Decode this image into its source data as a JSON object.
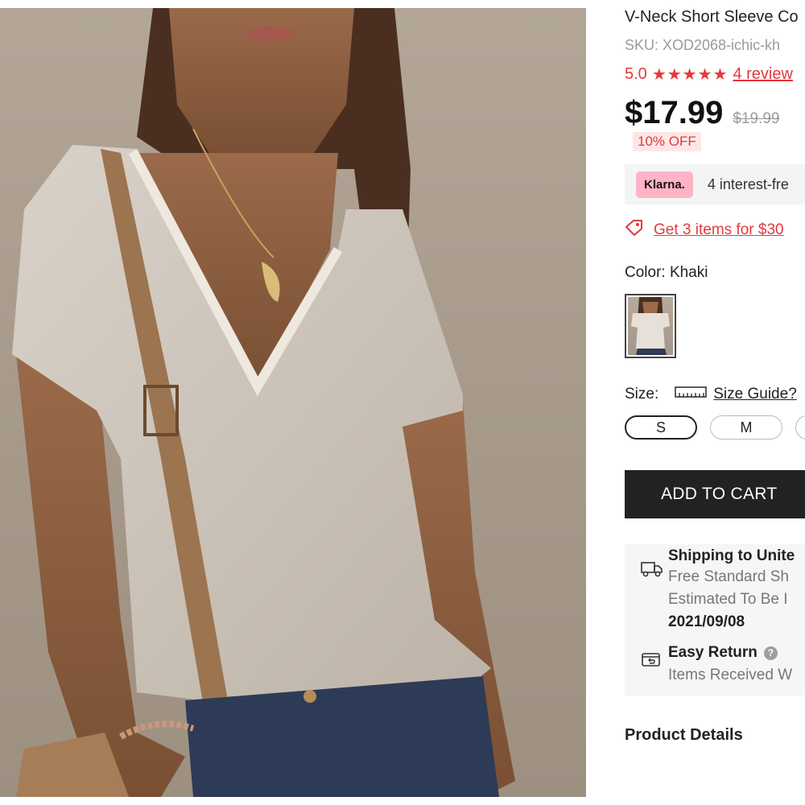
{
  "product": {
    "title": "V-Neck Short Sleeve Co",
    "sku": "SKU: XOD2068-ichic-kh",
    "rating": "5.0",
    "stars": "★★★★★",
    "reviews_link": "4 review",
    "price": "$17.99",
    "old_price": "$19.99",
    "discount_badge": "10% OFF"
  },
  "klarna": {
    "logo": "Klarna.",
    "text": "4 interest-fre"
  },
  "promo": {
    "link": "Get 3 items for $30"
  },
  "color": {
    "label": "Color:",
    "value": "Khaki"
  },
  "size": {
    "label": "Size:",
    "guide_link": "Size Guide?",
    "options": [
      "S",
      "M",
      ""
    ]
  },
  "cart": {
    "button_label": "ADD TO CART"
  },
  "shipping": {
    "title": "Shipping to Unite",
    "line1": "Free Standard Sh",
    "line2": "Estimated To Be I",
    "date": "2021/09/08"
  },
  "returns": {
    "title": "Easy Return",
    "help": "?",
    "text": "Items Received W"
  },
  "details": {
    "heading": "Product Details"
  },
  "icons": {
    "tag": "tag-icon",
    "ruler": "ruler-icon",
    "truck": "truck-icon",
    "return": "return-icon",
    "help": "help-icon"
  },
  "colors": {
    "accent": "#e4393c",
    "cart_bg": "#222222",
    "klarna_pink": "#ffb3c7"
  }
}
